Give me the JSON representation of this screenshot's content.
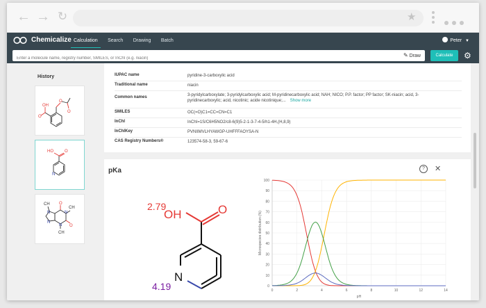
{
  "browser": {
    "back_icon": "arrow-left-icon",
    "forward_icon": "arrow-right-icon",
    "reload_icon": "reload-icon",
    "bookmark_icon": "star-icon"
  },
  "app": {
    "brand": "Chemicalize",
    "nav": [
      "Calculation",
      "Search",
      "Drawing",
      "Batch"
    ],
    "active_nav": "Calculation",
    "user": "Peter"
  },
  "search": {
    "placeholder": "Enter a molecule name, registry number, SMILES, or InChI (e.g. niacin)",
    "draw_label": "Draw",
    "calculate_label": "Calculate"
  },
  "history": {
    "title": "History",
    "items": [
      "aspirin",
      "niacin",
      "caffeine"
    ],
    "selected_index": 1
  },
  "properties": [
    {
      "key": "IUPAC name",
      "value": "pyridine-3-carboxylic acid"
    },
    {
      "key": "Traditional name",
      "value": "niacin"
    },
    {
      "key": "Common names",
      "value": "3-pyridylcarboxylate; 3-pyridylcarboxylic acid; M-pyridinecarboxylic acid; NAH; NICO; P.P. factor; PP factor; SK-niacin; acid, 3-pyridinecarboxylic; acid, nicotinic; acide nicotinique;...",
      "more": "Show more"
    },
    {
      "key": "SMILES",
      "value": "OC(=O)C1=CC=CN=C1"
    },
    {
      "key": "InChI",
      "value": "InChI=1S/C6H5NO2/c8-6(9)5-2-1-3-7-4-5/h1-4H,(H,8,9)"
    },
    {
      "key": "InChIKey",
      "value": "PVNIIMVLHYAWGP-UHFFFAOYSA-N"
    },
    {
      "key": "CAS Registry Numbers®",
      "value": "123574-58-3, 59-67-6"
    }
  ],
  "pka": {
    "title": "pKa",
    "acid_value": "2.79",
    "base_value": "4.19",
    "atom_o": "OH",
    "atom_o2": "O",
    "atom_n": "N"
  },
  "chart_data": {
    "type": "line",
    "xlabel": "pH",
    "ylabel": "Microspecies distribution (%)",
    "xlim": [
      0,
      14
    ],
    "ylim": [
      0,
      100
    ],
    "x_ticks": [
      0,
      2,
      4,
      6,
      8,
      10,
      12,
      14
    ],
    "y_ticks": [
      0,
      10,
      20,
      30,
      40,
      50,
      60,
      70,
      80,
      90,
      100
    ],
    "grid": true,
    "colors": {
      "red": "#e53935",
      "orange": "#ffb300",
      "green": "#43a047",
      "blue": "#5c6bc0"
    },
    "pka1": 2.79,
    "pka2": 4.19
  }
}
